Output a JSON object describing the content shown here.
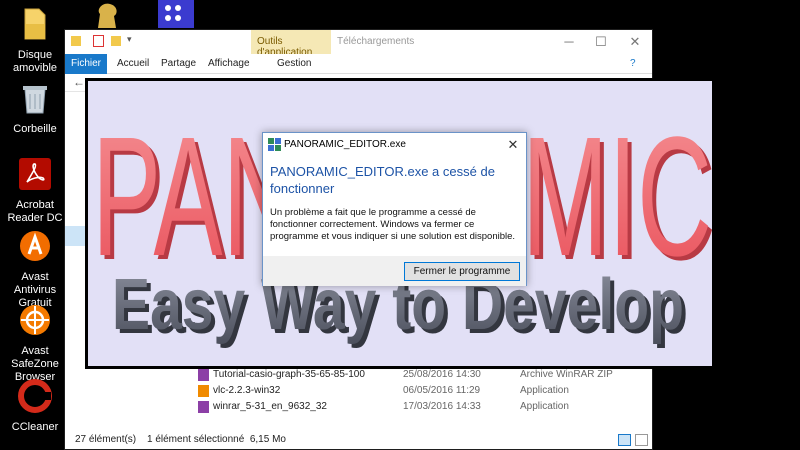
{
  "desktop": {
    "icons": [
      {
        "label_line1": "Disque amovible",
        "label_line2": "",
        "icon": "usb-drive-icon"
      },
      {
        "label_line1": "Corbeille",
        "label_line2": "",
        "icon": "recycle-bin-icon"
      },
      {
        "label_line1": "Acrobat",
        "label_line2": "Reader DC",
        "icon": "acrobat-icon"
      },
      {
        "label_line1": "Avast Antivirus",
        "label_line2": "Gratuit",
        "icon": "avast-icon"
      },
      {
        "label_line1": "Avast SafeZone",
        "label_line2": "Browser",
        "icon": "safezone-icon"
      },
      {
        "label_line1": "CCleaner",
        "label_line2": "",
        "icon": "ccleaner-icon"
      }
    ]
  },
  "explorer": {
    "context_tab": "Outils d'application",
    "window_title": "Téléchargements",
    "ribbon": {
      "file_tab": "Fichier",
      "tabs": [
        "Accueil",
        "Partage",
        "Affichage",
        "Gestion"
      ]
    },
    "files": [
      {
        "name": "Tutorial-casio-graph-35-65-85-100",
        "date": "25/08/2016 14:30",
        "type": "Archive WinRAR ZIP"
      },
      {
        "name": "vlc-2.2.3-win32",
        "date": "06/05/2016 11:29",
        "type": "Application"
      },
      {
        "name": "winrar_5-31_en_9632_32",
        "date": "17/03/2016 14:33",
        "type": "Application"
      }
    ],
    "status": {
      "count": "27 élément(s)",
      "selection": "1 élément sélectionné  6,15 Mo"
    }
  },
  "splash": {
    "logo_text": "PANORAMIC",
    "tagline": "Easy Way to Develop",
    "colors": {
      "logo": "#f06a72",
      "tagline": "#5e6270",
      "background": "#e2e0f6"
    }
  },
  "dialog": {
    "title": "PANORAMIC_EDITOR.exe",
    "heading": "PANORAMIC_EDITOR.exe a cessé de fonctionner",
    "body": "Un problème a fait que le programme a cessé de fonctionner correctement. Windows va fermer ce programme et vous indiquer si une solution est disponible.",
    "close_button": "Fermer le programme",
    "accent_color": "#1d53a6"
  }
}
